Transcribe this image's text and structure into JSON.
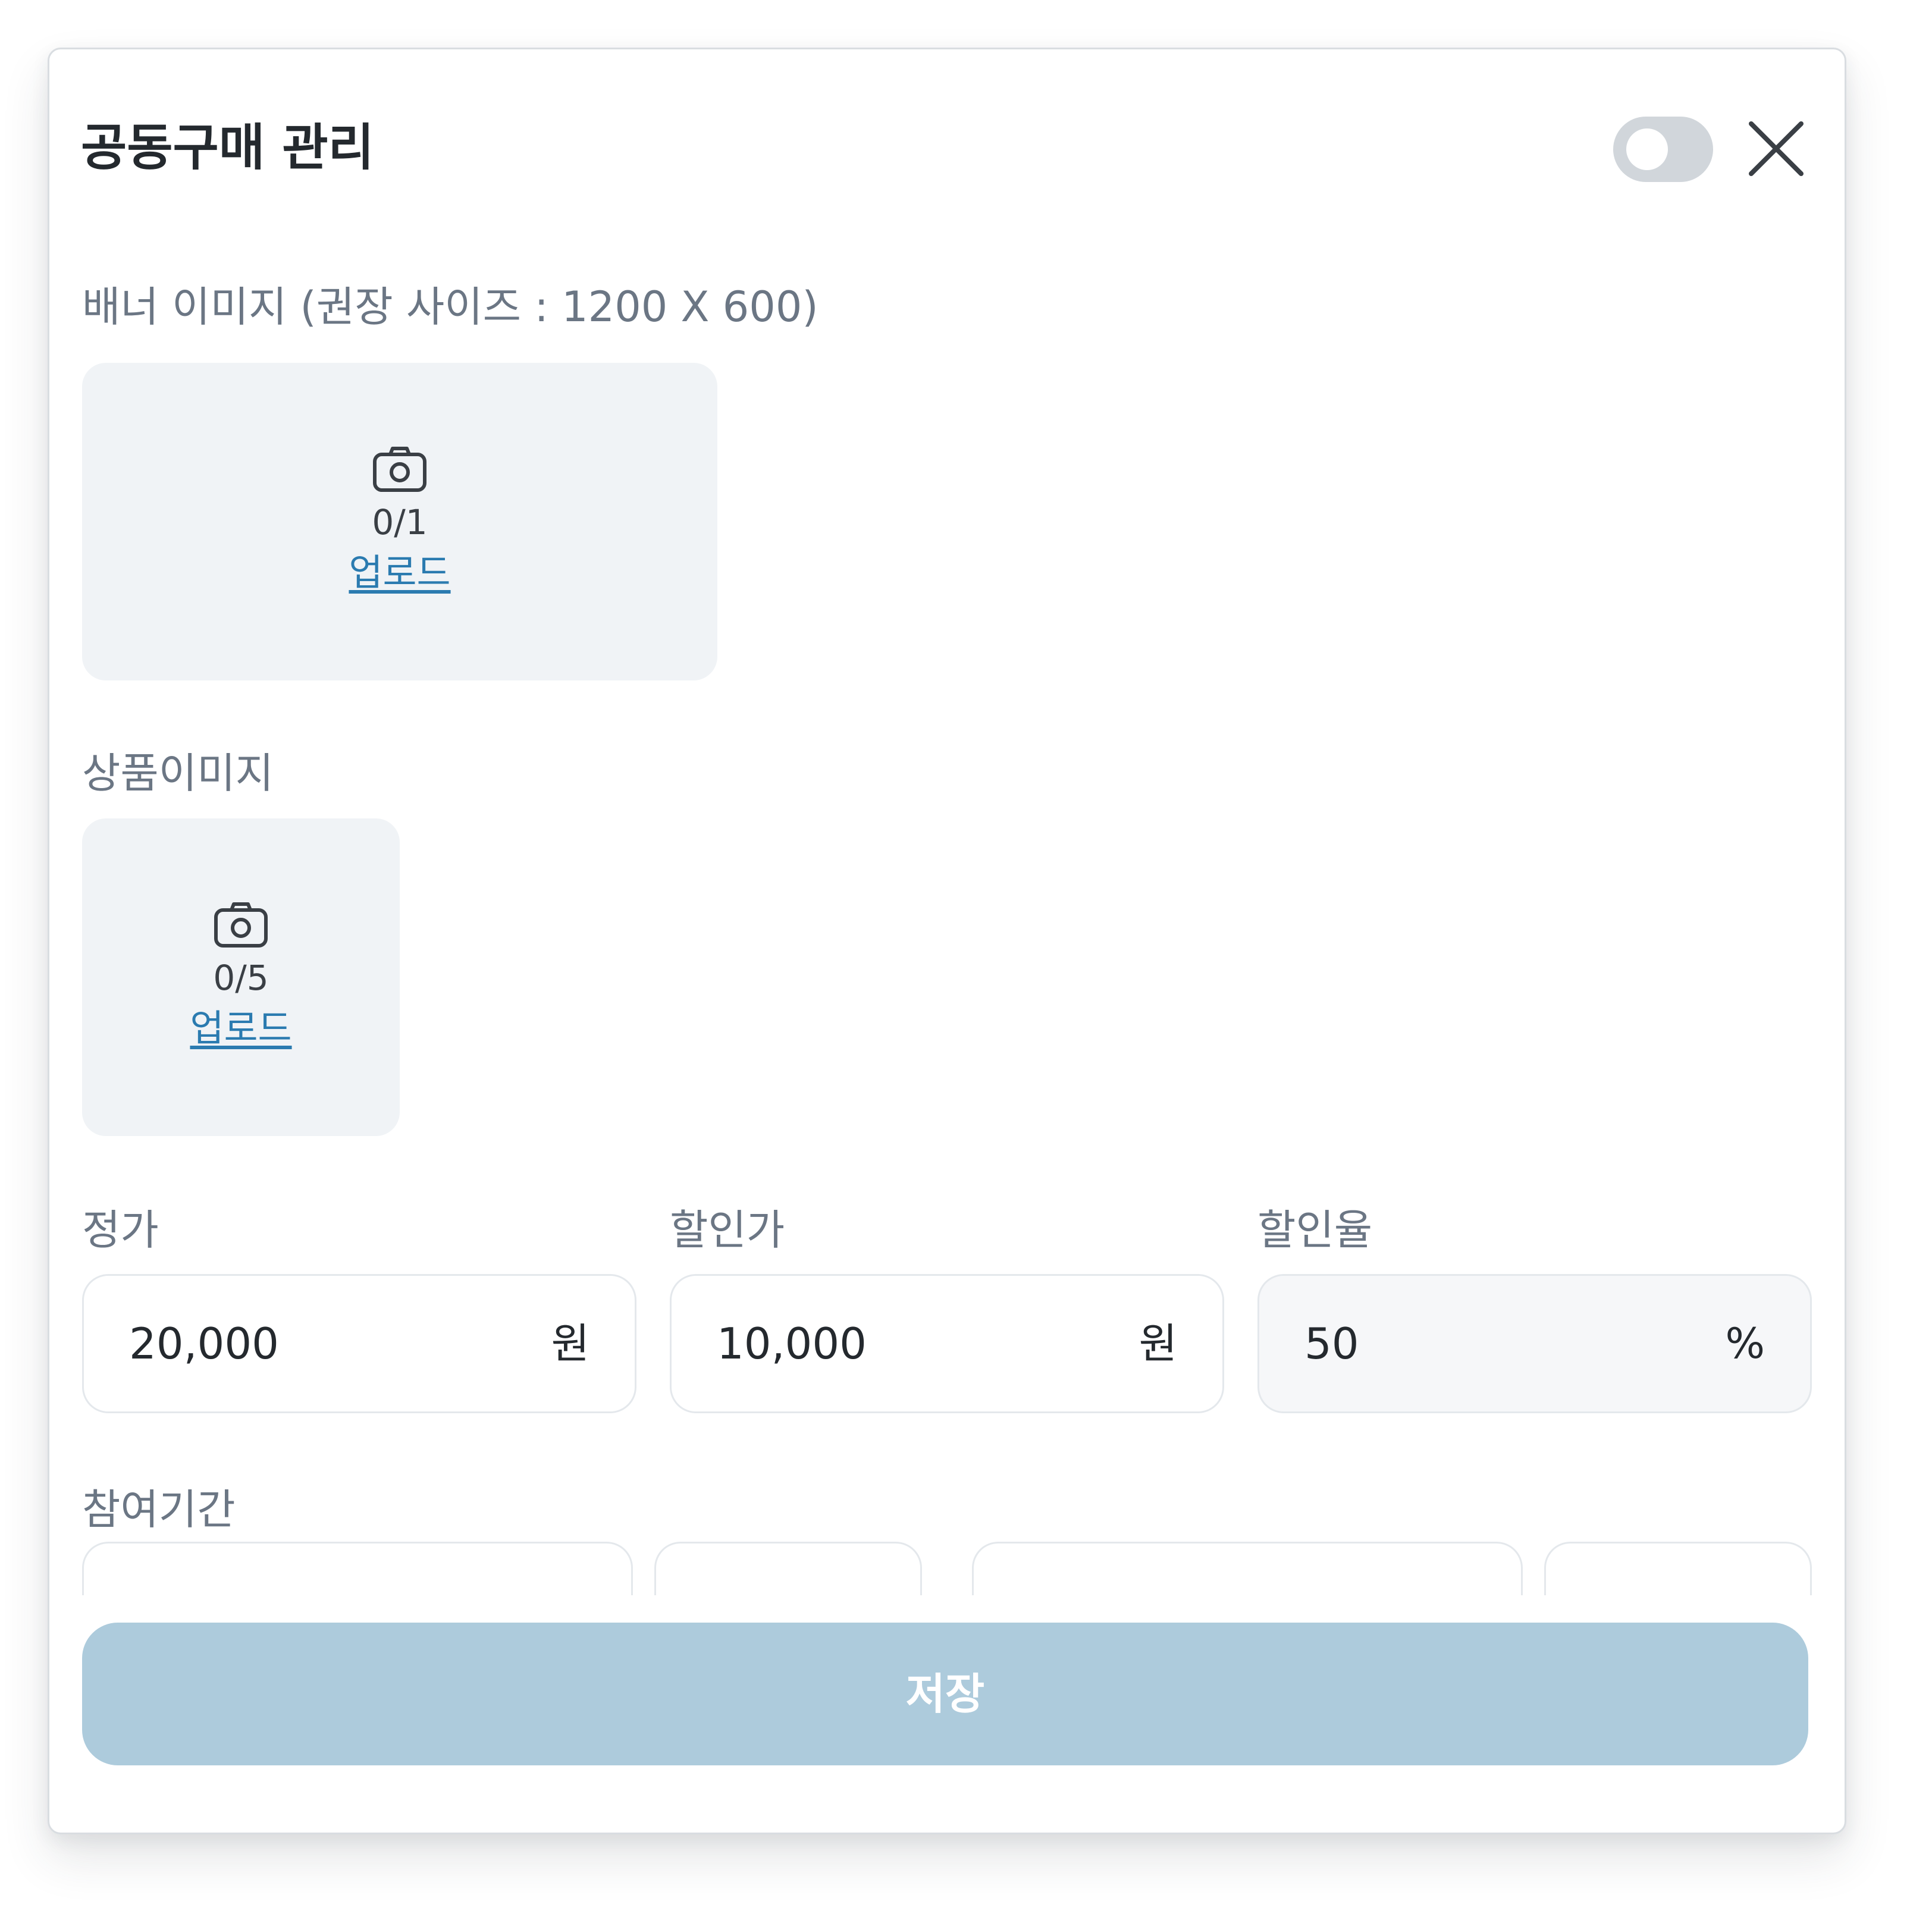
{
  "modal": {
    "title": "공동구매 관리",
    "toggle_on": false
  },
  "banner": {
    "label": "배너 이미지 (권장 사이즈 : 1200 X 600)",
    "count": "0/1",
    "upload_label": "업로드"
  },
  "product_images": {
    "label": "상품이미지",
    "count": "0/5",
    "upload_label": "업로드"
  },
  "pricing": {
    "list_price": {
      "label": "정가",
      "value": "20,000",
      "unit": "원"
    },
    "sale_price": {
      "label": "할인가",
      "value": "10,000",
      "unit": "원"
    },
    "discount_rate": {
      "label": "할인율",
      "value": "50",
      "unit": "%"
    }
  },
  "period": {
    "label": "참여기간"
  },
  "save_button": {
    "label": "저장"
  },
  "colors": {
    "accent_disabled": "#adcbdc",
    "link": "#2b7bb0",
    "toggle_off": "#d1d6db"
  }
}
